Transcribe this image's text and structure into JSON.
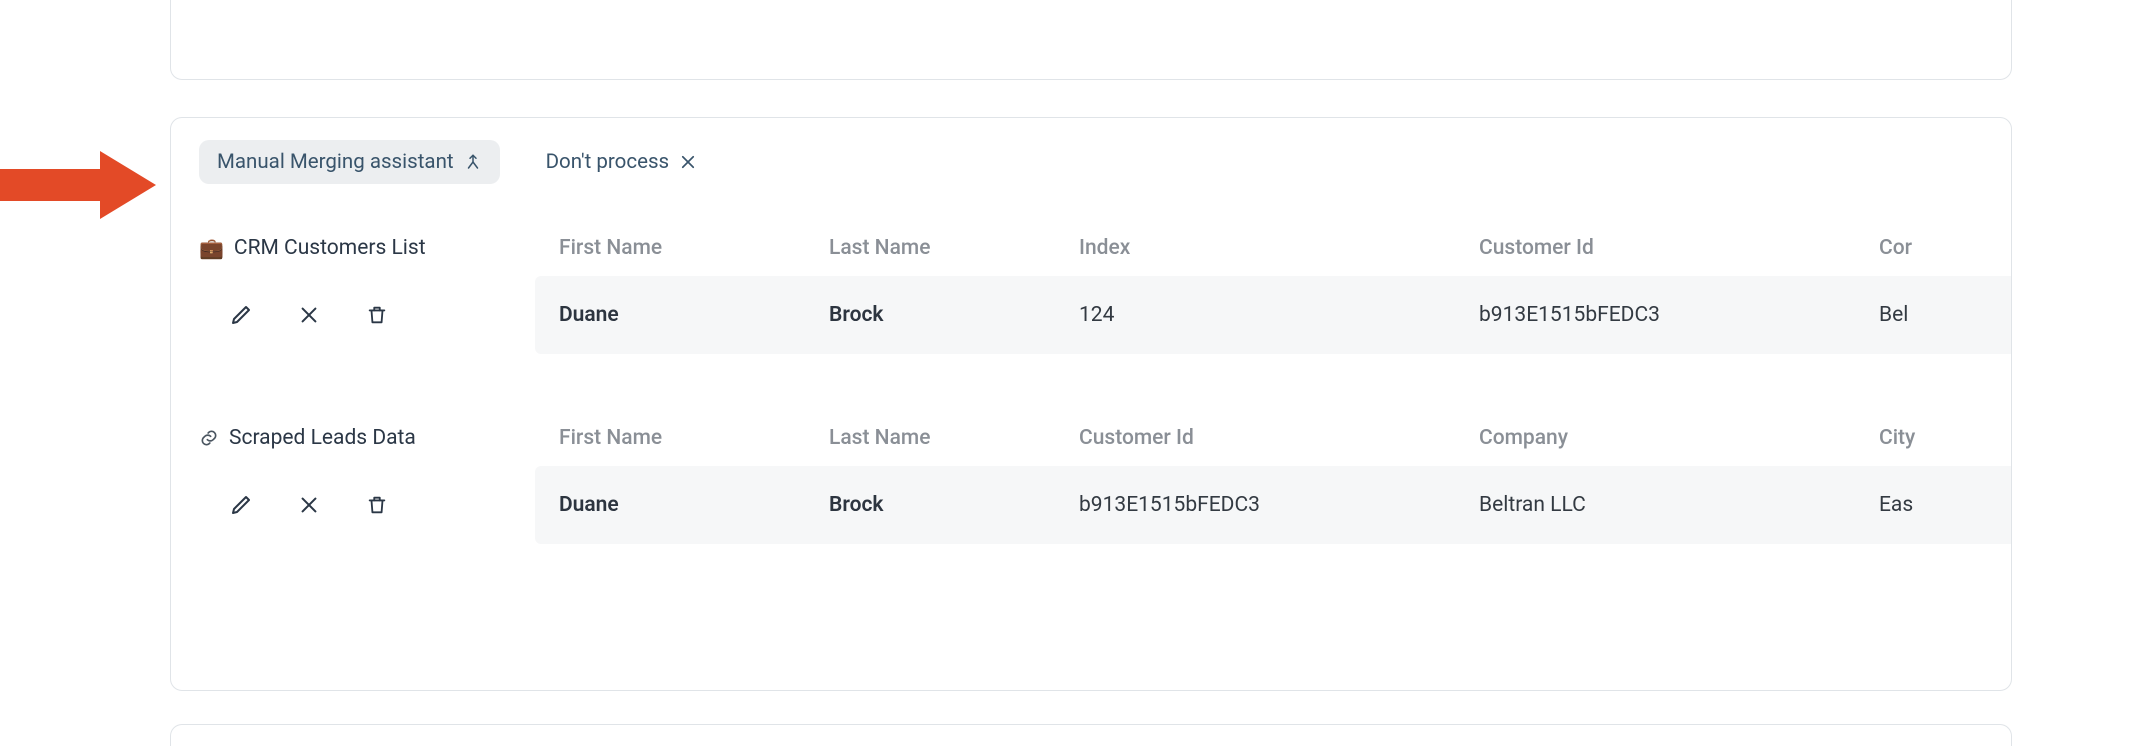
{
  "tabs": {
    "merge": {
      "label": "Manual Merging assistant"
    },
    "dont_process": {
      "label": "Don't process"
    }
  },
  "sources": [
    {
      "icon": "briefcase",
      "name": "CRM Customers List",
      "headers": [
        "First Name",
        "Last Name",
        "Index",
        "Customer Id",
        "Cor"
      ],
      "row": {
        "first_name": "Duane",
        "last_name": "Brock",
        "col3": "124",
        "col4": "b913E1515bFEDC3",
        "col5": "Bel"
      }
    },
    {
      "icon": "link",
      "name": "Scraped Leads Data",
      "headers": [
        "First Name",
        "Last Name",
        "Customer Id",
        "Company",
        "City"
      ],
      "row": {
        "first_name": "Duane",
        "last_name": "Brock",
        "col3": "b913E1515bFEDC3",
        "col4": "Beltran LLC",
        "col5": "Eas"
      }
    }
  ]
}
